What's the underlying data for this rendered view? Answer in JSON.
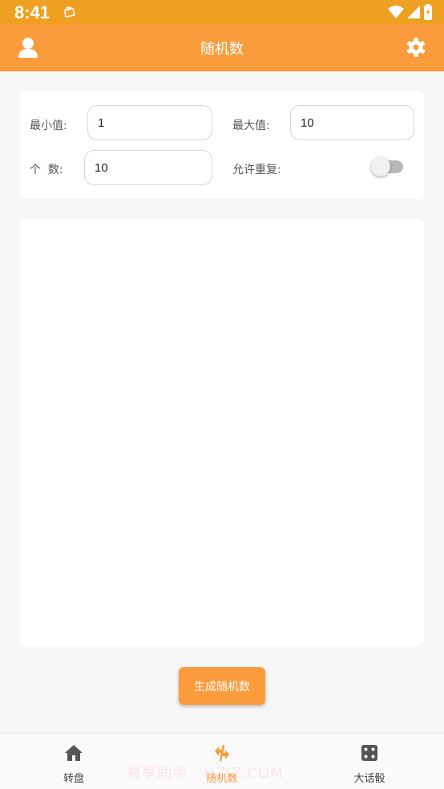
{
  "status_bar": {
    "time": "8:41"
  },
  "app_bar": {
    "title": "随机数"
  },
  "form": {
    "min_label": "最小值:",
    "min_value": "1",
    "max_label": "最大值:",
    "max_value": "10",
    "count_label": "个  数:",
    "count_value": "10",
    "repeat_label": "允许重复:",
    "repeat_enabled": false
  },
  "generate_button": {
    "label": "生成随机数"
  },
  "bottom_nav": {
    "items": [
      {
        "label": "转盘",
        "icon": "home-icon"
      },
      {
        "label": "随机数",
        "icon": "swap-icon",
        "active": true
      },
      {
        "label": "大话骰",
        "icon": "dice-icon"
      }
    ]
  },
  "watermark": {
    "text": "易享助手 · HZIZ.COM"
  },
  "colors": {
    "accent": "#fb9c3c",
    "status_bar": "#f0a020"
  }
}
